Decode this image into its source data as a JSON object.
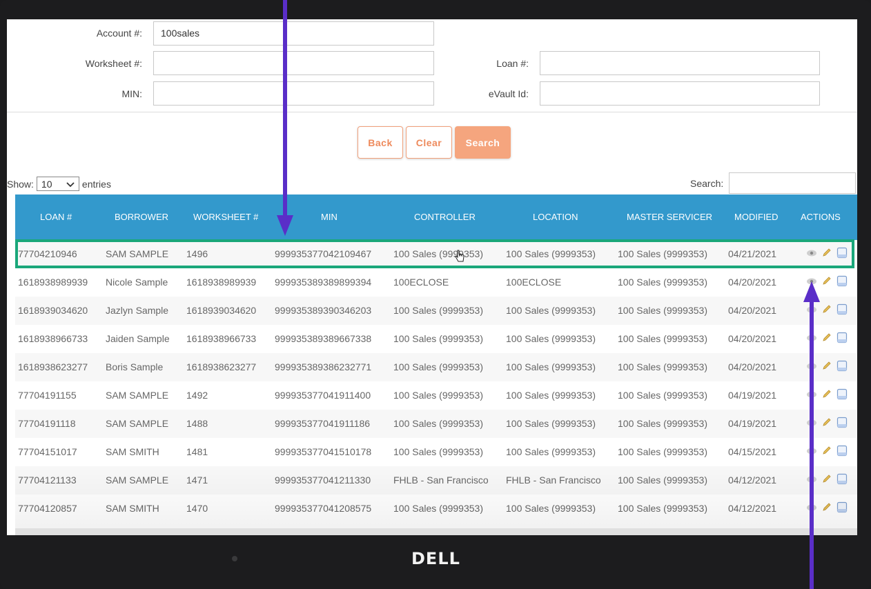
{
  "form": {
    "account_label": "Account #:",
    "account_value": "100sales",
    "worksheet_label": "Worksheet #:",
    "worksheet_value": "",
    "min_label": "MIN:",
    "min_value": "",
    "loan_label": "Loan #:",
    "loan_value": "",
    "evault_label": "eVault Id:",
    "evault_value": ""
  },
  "buttons": {
    "back": "Back",
    "clear": "Clear",
    "search": "Search"
  },
  "table_controls": {
    "show_label": "Show:",
    "page_size": "10",
    "entries_label": "entries",
    "search_label": "Search:"
  },
  "table": {
    "columns": [
      "LOAN #",
      "BORROWER",
      "WORKSHEET #",
      "MIN",
      "CONTROLLER",
      "LOCATION",
      "MASTER SERVICER",
      "MODIFIED",
      "ACTIONS"
    ],
    "rows": [
      [
        "77704210946",
        "SAM SAMPLE",
        "1496",
        "999935377042109467",
        "100 Sales (9999353)",
        "100 Sales (9999353)",
        "100 Sales (9999353)",
        "04/21/2021"
      ],
      [
        "1618938989939",
        "Nicole Sample",
        "1618938989939",
        "999935389389899394",
        "100ECLOSE",
        "100ECLOSE",
        "100 Sales (9999353)",
        "04/20/2021"
      ],
      [
        "1618939034620",
        "Jazlyn Sample",
        "1618939034620",
        "999935389390346203",
        "100 Sales (9999353)",
        "100 Sales (9999353)",
        "100 Sales (9999353)",
        "04/20/2021"
      ],
      [
        "1618938966733",
        "Jaiden Sample",
        "1618938966733",
        "999935389389667338",
        "100 Sales (9999353)",
        "100 Sales (9999353)",
        "100 Sales (9999353)",
        "04/20/2021"
      ],
      [
        "1618938623277",
        "Boris Sample",
        "1618938623277",
        "999935389386232771",
        "100 Sales (9999353)",
        "100 Sales (9999353)",
        "100 Sales (9999353)",
        "04/20/2021"
      ],
      [
        "77704191155",
        "SAM SAMPLE",
        "1492",
        "999935377041911400",
        "100 Sales (9999353)",
        "100 Sales (9999353)",
        "100 Sales (9999353)",
        "04/19/2021"
      ],
      [
        "77704191118",
        "SAM SAMPLE",
        "1488",
        "999935377041911186",
        "100 Sales (9999353)",
        "100 Sales (9999353)",
        "100 Sales (9999353)",
        "04/19/2021"
      ],
      [
        "77704151017",
        "SAM SMITH",
        "1481",
        "999935377041510178",
        "100 Sales (9999353)",
        "100 Sales (9999353)",
        "100 Sales (9999353)",
        "04/15/2021"
      ],
      [
        "77704121133",
        "SAM SAMPLE",
        "1471",
        "999935377041211330",
        "FHLB - San Francisco",
        "FHLB - San Francisco",
        "100 Sales (9999353)",
        "04/12/2021"
      ],
      [
        "77704120857",
        "SAM SMITH",
        "1470",
        "999935377041208575",
        "100 Sales (9999353)",
        "100 Sales (9999353)",
        "100 Sales (9999353)",
        "04/12/2021"
      ]
    ],
    "actions": [
      "view-icon",
      "edit-icon",
      "document-icon"
    ],
    "header_color": "#3399cc",
    "highlight_color": "#1aa77a"
  },
  "device": {
    "brand_logo": "DELL"
  },
  "annotations": {
    "arrow_color": "#5a2ec8"
  },
  "colors": {
    "accent": "#f5a57e",
    "accent_text": "#ee8a5c"
  }
}
